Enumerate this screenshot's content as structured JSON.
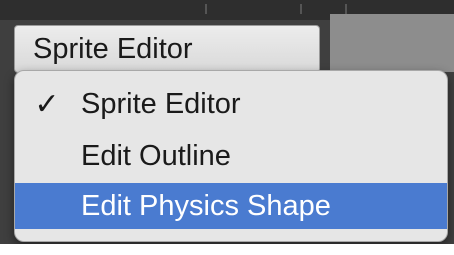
{
  "dropdown": {
    "selected_label": "Sprite Editor"
  },
  "menu": {
    "items": [
      {
        "label": "Sprite Editor",
        "checked": true,
        "check_glyph": "✓",
        "highlighted": false
      },
      {
        "label": "Edit Outline",
        "checked": false,
        "check_glyph": "",
        "highlighted": false
      },
      {
        "label": "Edit Physics Shape",
        "checked": false,
        "check_glyph": "",
        "highlighted": true
      }
    ]
  },
  "colors": {
    "highlight": "#4a7bd0",
    "menu_background": "#e6e6e6",
    "editor_background": "#3f3f3f"
  },
  "icons": {
    "check": "checkmark-icon"
  }
}
